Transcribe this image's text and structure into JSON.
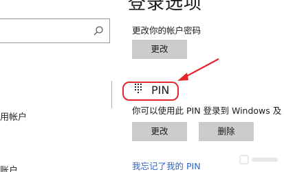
{
  "window": {
    "title": "登录选项"
  },
  "search": {
    "value": "",
    "icon": "search-icon"
  },
  "sidebar": {
    "items": [
      {
        "label": "用帐户"
      },
      {
        "label": "账户"
      }
    ]
  },
  "password": {
    "description": "更改你的帐户密码",
    "change_label": "更改"
  },
  "pin": {
    "title": "PIN",
    "icon": "keypad-icon",
    "description": "你可以使用此 PIN 登录到 Windows 及",
    "change_label": "更改",
    "remove_label": "删除",
    "forgot_link": "我忘记了我的 PIN"
  },
  "annotation": {
    "highlight_color": "#e3262b"
  }
}
